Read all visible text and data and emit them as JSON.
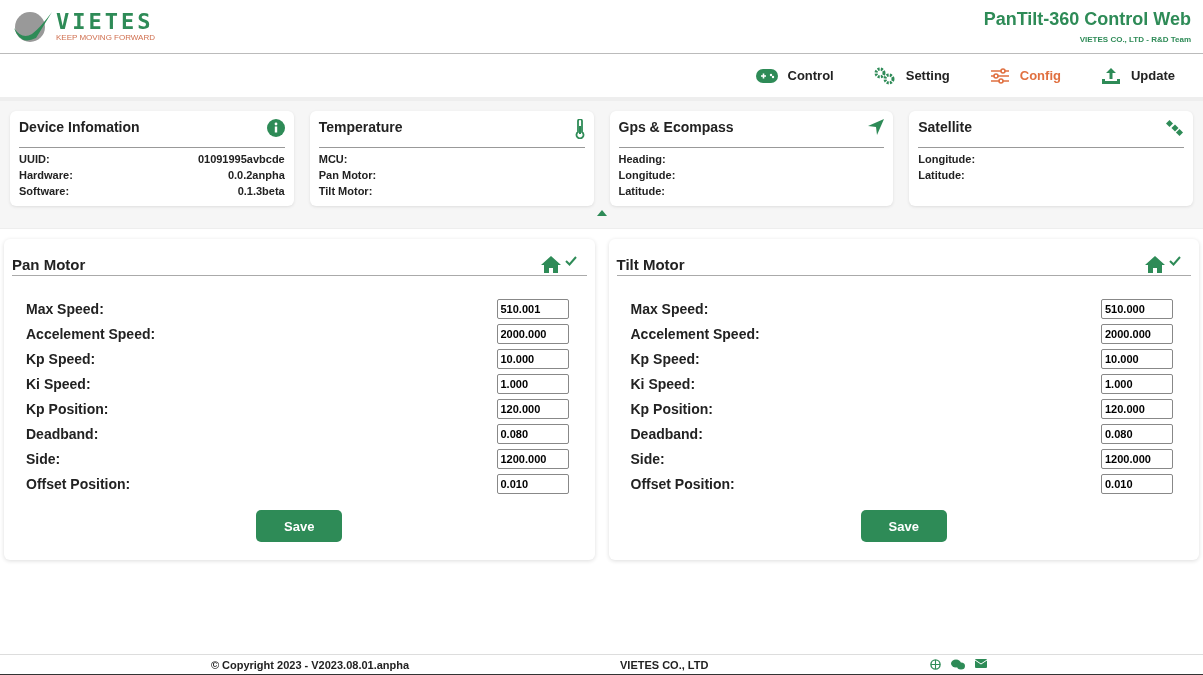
{
  "header": {
    "logo_text": "VIETES",
    "logo_slogan": "KEEP MOVING FORWARD",
    "title": "PanTilt-360 Control Web",
    "subtitle": "VIETES CO., LTD - R&D Team"
  },
  "nav": [
    {
      "label": "Control",
      "selected": false
    },
    {
      "label": "Setting",
      "selected": false
    },
    {
      "label": "Config",
      "selected": true
    },
    {
      "label": "Update",
      "selected": false
    }
  ],
  "info_cards": [
    {
      "title": "Device Infomation",
      "rows": [
        {
          "label": "UUID:",
          "value": "01091995avbcde"
        },
        {
          "label": "Hardware:",
          "value": "0.0.2anpha"
        },
        {
          "label": "Software:",
          "value": "0.1.3beta"
        }
      ]
    },
    {
      "title": "Temperature",
      "rows": [
        {
          "label": "MCU:"
        },
        {
          "label": "Pan Motor:"
        },
        {
          "label": "Tilt Motor:"
        }
      ]
    },
    {
      "title": "Gps & Ecompass",
      "rows": [
        {
          "label": "Heading:"
        },
        {
          "label": "Longitude:"
        },
        {
          "label": "Latitude:"
        }
      ]
    },
    {
      "title": "Satellite",
      "rows": [
        {
          "label": "Longitude:"
        },
        {
          "label": "Latitude:"
        }
      ]
    }
  ],
  "motors": [
    {
      "title": "Pan Motor",
      "confirmed": true,
      "fields": [
        {
          "label": "Max Speed:",
          "value": "510.001"
        },
        {
          "label": "Accelement Speed:",
          "value": "2000.000"
        },
        {
          "label": "Kp Speed:",
          "value": "10.000"
        },
        {
          "label": "Ki Speed:",
          "value": "1.000"
        },
        {
          "label": "Kp Position:",
          "value": "120.000"
        },
        {
          "label": "Deadband:",
          "value": "0.080"
        },
        {
          "label": "Side:",
          "value": "1200.000"
        },
        {
          "label": "Offset Position:",
          "value": "0.010"
        }
      ],
      "button": "Save"
    },
    {
      "title": "Tilt Motor",
      "confirmed": true,
      "fields": [
        {
          "label": "Max Speed:",
          "value": "510.000"
        },
        {
          "label": "Accelement Speed:",
          "value": "2000.000"
        },
        {
          "label": "Kp Speed:",
          "value": "10.000"
        },
        {
          "label": "Ki Speed:",
          "value": "1.000"
        },
        {
          "label": "Kp Position:",
          "value": "120.000"
        },
        {
          "label": "Deadband:",
          "value": "0.080"
        },
        {
          "label": "Side:",
          "value": "1200.000"
        },
        {
          "label": "Offset Position:",
          "value": "0.010"
        }
      ],
      "button": "Save"
    }
  ],
  "footer": {
    "copyright": "© Copyright 2023 - V2023.08.01.anpha",
    "company": "VIETES CO., LTD"
  }
}
